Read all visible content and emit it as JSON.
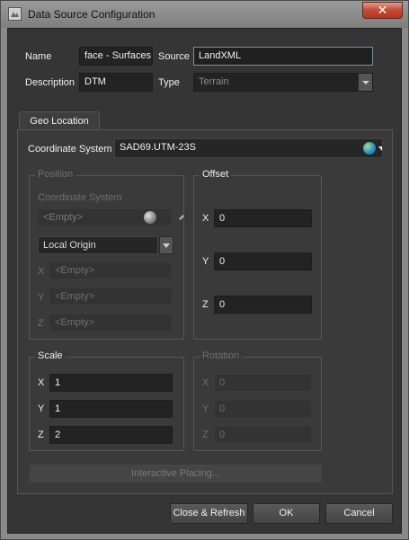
{
  "window": {
    "title": "Data Source Configuration",
    "close_label": "✕"
  },
  "general": {
    "name_label": "Name",
    "name_value": "face - Surfaces",
    "source_label": "Source",
    "source_value": "LandXML",
    "description_label": "Description",
    "description_value": "DTM",
    "type_label": "Type",
    "type_value": "Terrain"
  },
  "tabs": [
    {
      "label": "Geo Location",
      "selected": true
    }
  ],
  "geo": {
    "coord_system_label": "Coordinate System",
    "coord_system_value": "SAD69.UTM-23S",
    "position": {
      "title": "Position",
      "coord_system_label": "Coordinate System",
      "coord_system_value": "<Empty>",
      "origin_value": "Local Origin",
      "x_label": "X",
      "x_value": "<Empty>",
      "y_label": "Y",
      "y_value": "<Empty>",
      "z_label": "Z",
      "z_value": "<Empty>"
    },
    "offset": {
      "title": "Offset",
      "x_label": "X",
      "x_value": "0",
      "y_label": "Y",
      "y_value": "0",
      "z_label": "Z",
      "z_value": "0"
    },
    "scale": {
      "title": "Scale",
      "x_label": "X",
      "x_value": "1",
      "y_label": "Y",
      "y_value": "1",
      "z_label": "Z",
      "z_value": "2"
    },
    "rotation": {
      "title": "Rotation",
      "x_label": "X",
      "x_value": "0",
      "y_label": "Y",
      "y_value": "0",
      "z_label": "Z",
      "z_value": "0"
    },
    "interactive_placing_label": "Interactive Placing..."
  },
  "footer": {
    "close_refresh_label": "Close & Refresh",
    "ok_label": "OK",
    "cancel_label": "Cancel"
  },
  "icons": {
    "app": "app-icon",
    "globe": "globe-icon",
    "sphere": "sphere-icon"
  },
  "colors": {
    "panel": "#3a3a3a",
    "field": "#232323",
    "accent_focus": "#7d8fa3",
    "close": "#c34a33"
  }
}
